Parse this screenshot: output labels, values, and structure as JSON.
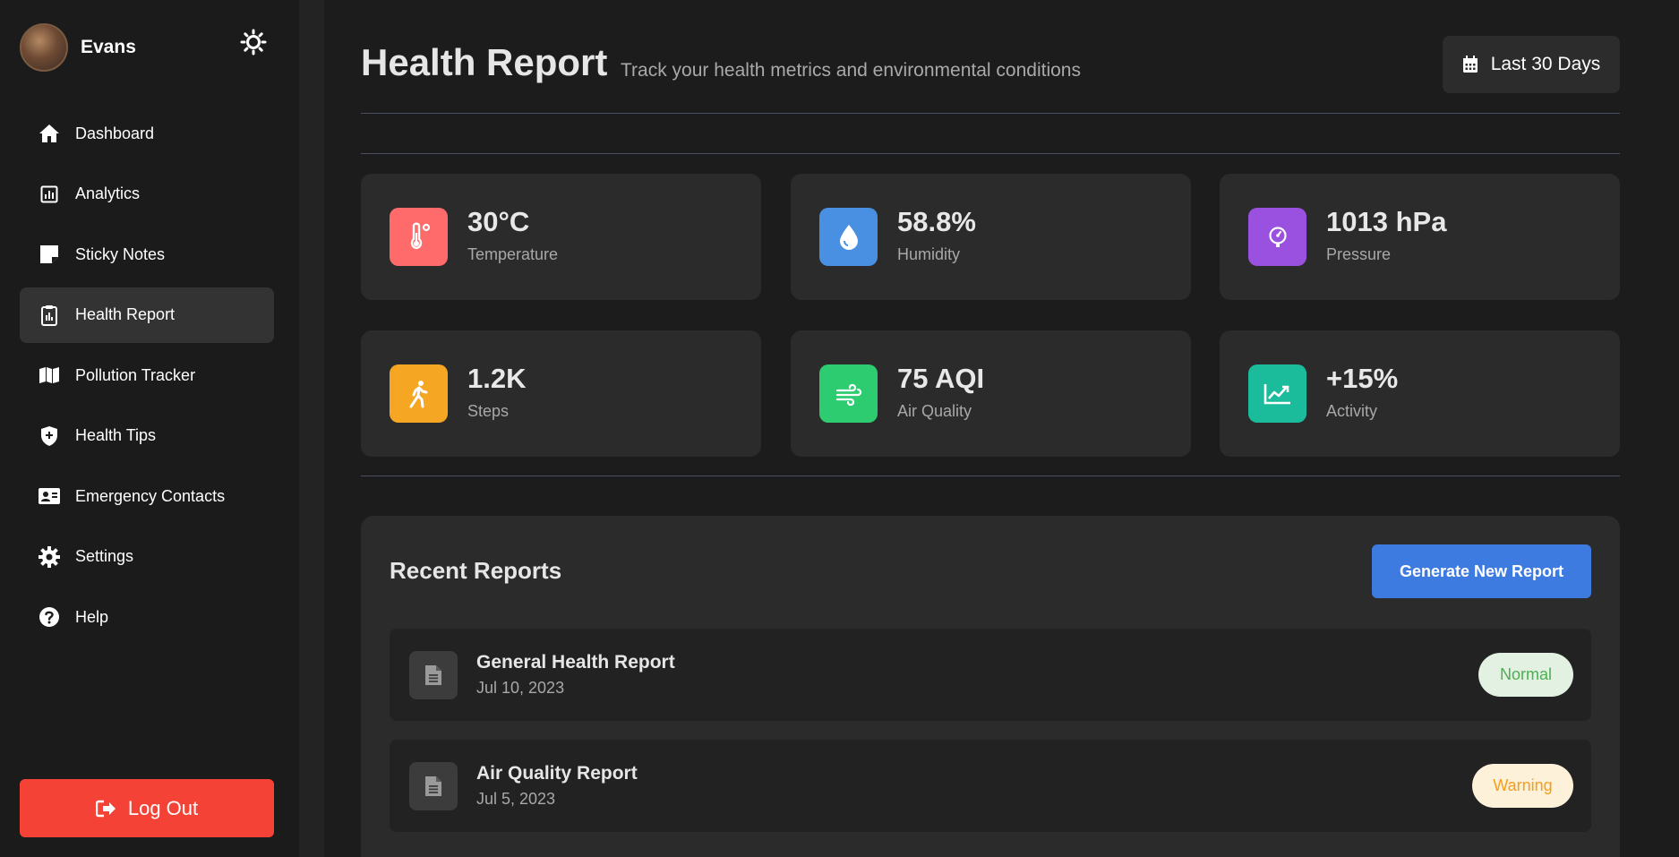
{
  "user": {
    "name": "Evans"
  },
  "sidebar": {
    "items": [
      {
        "label": "Dashboard",
        "icon": "home-icon",
        "active": false
      },
      {
        "label": "Analytics",
        "icon": "analytics-icon",
        "active": false
      },
      {
        "label": "Sticky Notes",
        "icon": "sticky-note-icon",
        "active": false
      },
      {
        "label": "Health Report",
        "icon": "clipboard-icon",
        "active": true
      },
      {
        "label": "Pollution Tracker",
        "icon": "map-icon",
        "active": false
      },
      {
        "label": "Health Tips",
        "icon": "shield-plus-icon",
        "active": false
      },
      {
        "label": "Emergency Contacts",
        "icon": "contact-card-icon",
        "active": false
      },
      {
        "label": "Settings",
        "icon": "gear-icon",
        "active": false
      },
      {
        "label": "Help",
        "icon": "question-circle-icon",
        "active": false
      }
    ],
    "logout_label": "Log Out"
  },
  "header": {
    "title": "Health Report",
    "subtitle": "Track your health metrics and environmental conditions",
    "date_range_label": "Last 30 Days"
  },
  "stats": [
    {
      "value": "30°C",
      "label": "Temperature",
      "icon": "thermometer-icon",
      "color": "#ff6b6b"
    },
    {
      "value": "58.8%",
      "label": "Humidity",
      "icon": "droplet-icon",
      "color": "#4a90e2"
    },
    {
      "value": "1013 hPa",
      "label": "Pressure",
      "icon": "gauge-icon",
      "color": "#9b51e0"
    },
    {
      "value": "1.2K",
      "label": "Steps",
      "icon": "walking-icon",
      "color": "#f5a623"
    },
    {
      "value": "75 AQI",
      "label": "Air Quality",
      "icon": "wind-icon",
      "color": "#2ecc71"
    },
    {
      "value": "+15%",
      "label": "Activity",
      "icon": "line-chart-icon",
      "color": "#1abc9c"
    }
  ],
  "reports": {
    "title": "Recent Reports",
    "generate_label": "Generate New Report",
    "items": [
      {
        "name": "General Health Report",
        "date": "Jul 10, 2023",
        "status": "Normal"
      },
      {
        "name": "Air Quality Report",
        "date": "Jul 5, 2023",
        "status": "Warning"
      }
    ]
  },
  "colors": {
    "accent": "#3e7be0",
    "logout": "#f44336",
    "status_normal": "#4caf50",
    "status_warning": "#f59e1b"
  }
}
